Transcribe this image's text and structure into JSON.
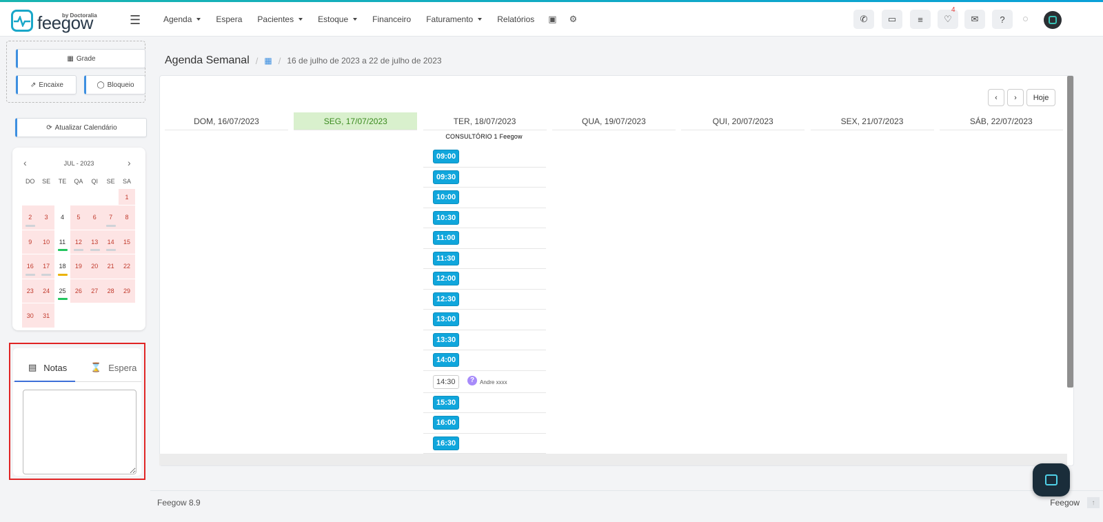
{
  "brand": {
    "name": "feegow",
    "by": "by Doctoralia"
  },
  "nav": {
    "items": [
      {
        "label": "Agenda",
        "dropdown": true
      },
      {
        "label": "Espera",
        "dropdown": false
      },
      {
        "label": "Pacientes",
        "dropdown": true
      },
      {
        "label": "Estoque",
        "dropdown": true
      },
      {
        "label": "Financeiro",
        "dropdown": false
      },
      {
        "label": "Faturamento",
        "dropdown": true
      },
      {
        "label": "Relatórios",
        "dropdown": false
      }
    ]
  },
  "toolbar": {
    "icons": [
      "phone-icon",
      "inbox-icon",
      "tasks-icon",
      "bell-icon",
      "chat-icon",
      "help-icon"
    ],
    "notification_count": "4"
  },
  "sidebar": {
    "grade_label": "Grade",
    "encaixe_label": "Encaixe",
    "bloqueio_label": "Bloqueio",
    "refresh_label": "Atualizar Calendário",
    "calendar": {
      "month_label": "JUL - 2023",
      "weekdays": [
        "DO",
        "SE",
        "TE",
        "QA",
        "QI",
        "SE",
        "SA"
      ],
      "days": [
        {
          "d": "",
          "closed": false
        },
        {
          "d": "",
          "closed": false
        },
        {
          "d": "",
          "closed": false
        },
        {
          "d": "",
          "closed": false
        },
        {
          "d": "",
          "closed": false
        },
        {
          "d": "",
          "closed": false
        },
        {
          "d": "1",
          "closed": true
        },
        {
          "d": "2",
          "closed": true,
          "bar": "#cfd3d8"
        },
        {
          "d": "3",
          "closed": true
        },
        {
          "d": "4",
          "closed": false
        },
        {
          "d": "5",
          "closed": true
        },
        {
          "d": "6",
          "closed": true
        },
        {
          "d": "7",
          "closed": true,
          "bar": "#cfd3d8"
        },
        {
          "d": "8",
          "closed": true
        },
        {
          "d": "9",
          "closed": true
        },
        {
          "d": "10",
          "closed": true
        },
        {
          "d": "11",
          "closed": false,
          "bar": "#22c55e"
        },
        {
          "d": "12",
          "closed": true,
          "bar": "#cfd3d8"
        },
        {
          "d": "13",
          "closed": true,
          "bar": "#cfd3d8"
        },
        {
          "d": "14",
          "closed": true,
          "bar": "#cfd3d8"
        },
        {
          "d": "15",
          "closed": true
        },
        {
          "d": "16",
          "closed": true,
          "bar": "#cfd3d8"
        },
        {
          "d": "17",
          "closed": true,
          "bar": "#cfd3d8"
        },
        {
          "d": "18",
          "closed": false,
          "bar": "#eab308"
        },
        {
          "d": "19",
          "closed": true
        },
        {
          "d": "20",
          "closed": true
        },
        {
          "d": "21",
          "closed": true
        },
        {
          "d": "22",
          "closed": true
        },
        {
          "d": "23",
          "closed": true
        },
        {
          "d": "24",
          "closed": true
        },
        {
          "d": "25",
          "closed": false,
          "bar": "#22c55e"
        },
        {
          "d": "26",
          "closed": true
        },
        {
          "d": "27",
          "closed": true
        },
        {
          "d": "28",
          "closed": true
        },
        {
          "d": "29",
          "closed": true
        },
        {
          "d": "30",
          "closed": true
        },
        {
          "d": "31",
          "closed": true
        }
      ]
    },
    "notes": {
      "tab_notas": "Notas",
      "tab_espera": "Espera",
      "textarea_value": ""
    }
  },
  "main": {
    "title": "Agenda Semanal",
    "date_range": "16 de julho de 2023 a 22 de julho de 2023",
    "today_button": "Hoje",
    "days": [
      {
        "label": "DOM, 16/07/2023",
        "today": false
      },
      {
        "label": "SEG, 17/07/2023",
        "today": true
      },
      {
        "label": "TER, 18/07/2023",
        "today": false
      },
      {
        "label": "QUA, 19/07/2023",
        "today": false
      },
      {
        "label": "QUI, 20/07/2023",
        "today": false
      },
      {
        "label": "SEX, 21/07/2023",
        "today": false
      },
      {
        "label": "SÁB, 22/07/2023",
        "today": false
      }
    ],
    "room": "CONSULTÓRIO 1 Feegow",
    "slots": [
      {
        "time": "09:00"
      },
      {
        "time": "09:30"
      },
      {
        "time": "10:00"
      },
      {
        "time": "10:30"
      },
      {
        "time": "11:00"
      },
      {
        "time": "11:30"
      },
      {
        "time": "12:00"
      },
      {
        "time": "12:30"
      },
      {
        "time": "13:00"
      },
      {
        "time": "13:30"
      },
      {
        "time": "14:00"
      },
      {
        "time": "14:30",
        "patient": "Andre xxxx"
      },
      {
        "time": "15:30"
      },
      {
        "time": "16:00"
      },
      {
        "time": "16:30"
      }
    ]
  },
  "footer": {
    "version": "Feegow 8.9",
    "brand": "Feegow"
  }
}
